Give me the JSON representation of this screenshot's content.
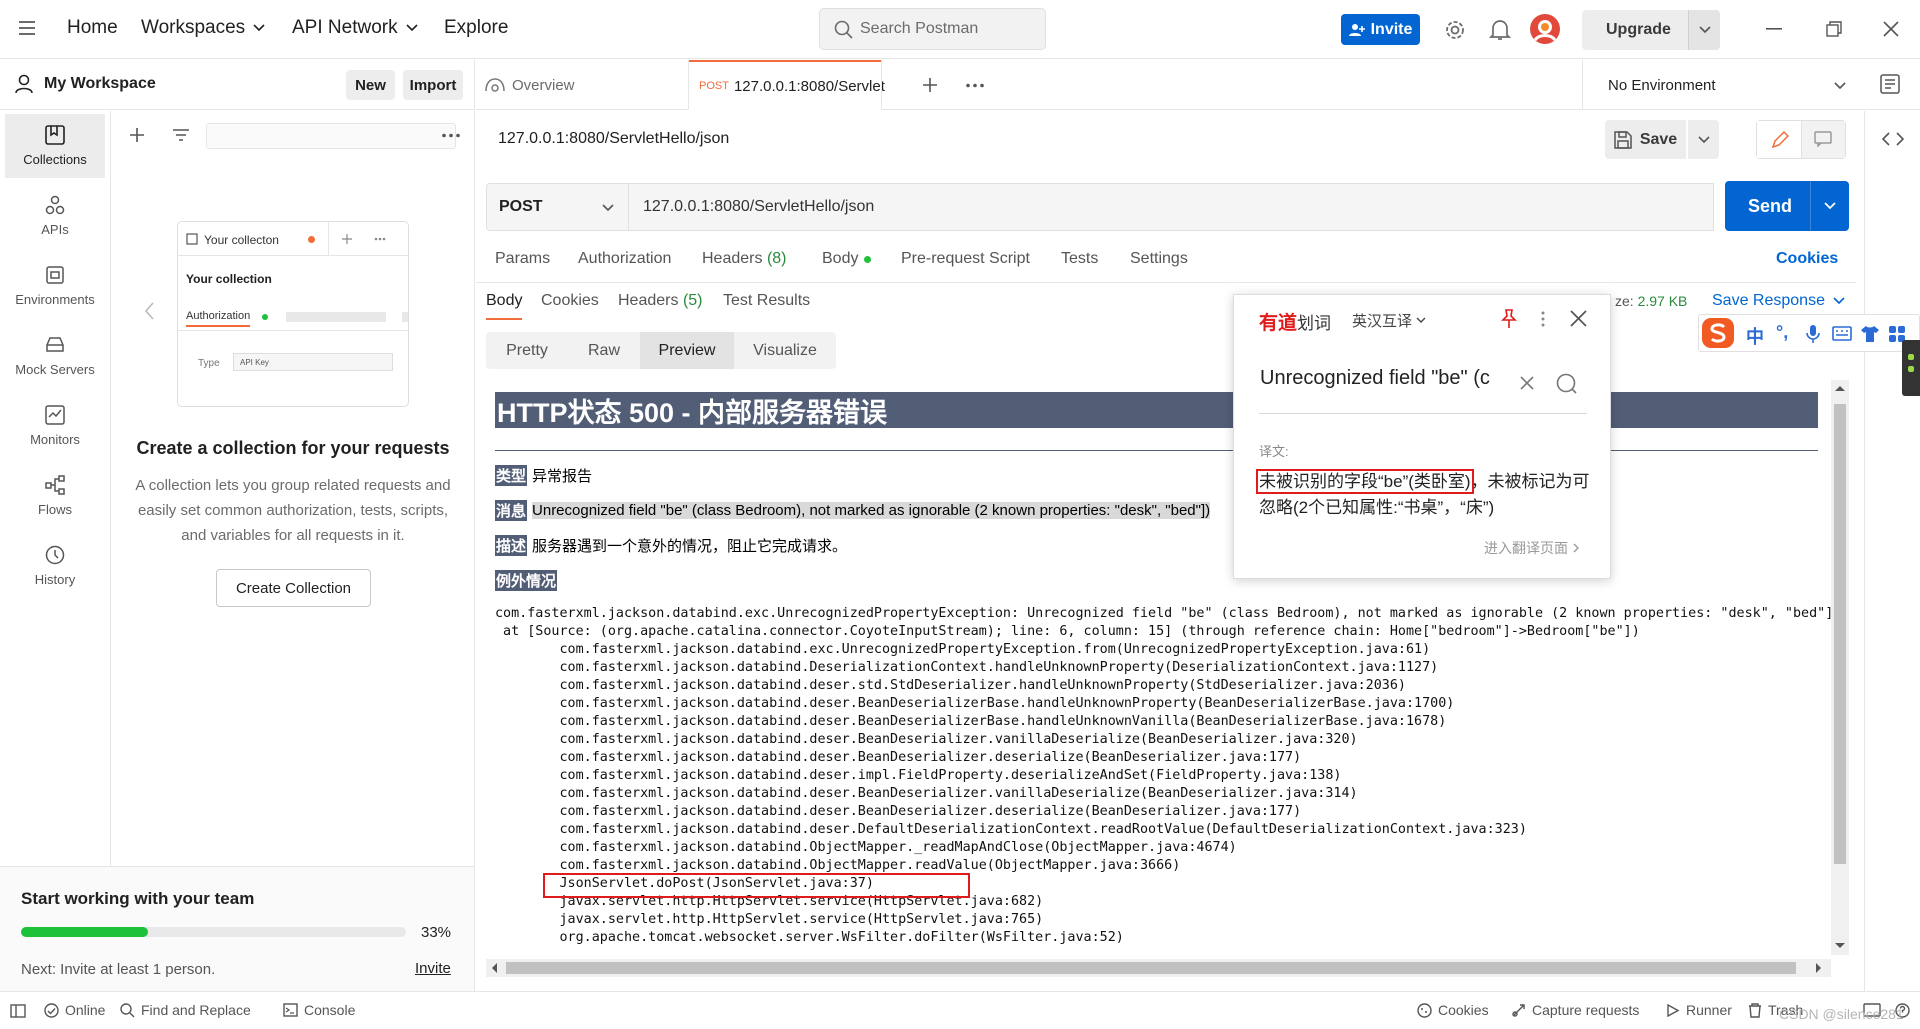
{
  "topbar": {
    "home": "Home",
    "workspaces": "Workspaces",
    "api_network": "API Network",
    "explore": "Explore",
    "search_placeholder": "Search Postman",
    "invite": "Invite",
    "upgrade": "Upgrade"
  },
  "workspace": {
    "title": "My Workspace",
    "new": "New",
    "import": "Import"
  },
  "leftnav": [
    {
      "label": "Collections",
      "icon": "collections-icon"
    },
    {
      "label": "APIs",
      "icon": "apis-icon"
    },
    {
      "label": "Environments",
      "icon": "environments-icon"
    },
    {
      "label": "Mock Servers",
      "icon": "mock-servers-icon"
    },
    {
      "label": "Monitors",
      "icon": "monitors-icon"
    },
    {
      "label": "Flows",
      "icon": "flows-icon"
    },
    {
      "label": "History",
      "icon": "history-icon"
    }
  ],
  "collection_empty": {
    "illus_tab": "Your collecton",
    "illus_name": "Your collection",
    "illus_auth": "Authorization",
    "illus_type": "Type",
    "illus_type_value": "API Key",
    "title": "Create a collection for your requests",
    "desc": "A collection lets you group related requests and easily set common authorization, tests, scripts, and variables for all requests in it.",
    "button": "Create Collection"
  },
  "team": {
    "title": "Start working with your team",
    "progress": 0.33,
    "progress_label": "33%",
    "next": "Next: Invite at least 1 person.",
    "invite": "Invite"
  },
  "tabs": {
    "overview": "Overview",
    "request_method": "POST",
    "request_label": "127.0.0.1:8080/Servlet"
  },
  "environment": "No Environment",
  "request": {
    "title": "127.0.0.1:8080/ServletHello/json",
    "save": "Save",
    "method": "POST",
    "url": "127.0.0.1:8080/ServletHello/json",
    "send": "Send"
  },
  "request_tabs": {
    "params": "Params",
    "authorization": "Authorization",
    "headers": "Headers",
    "headers_count": "(8)",
    "body": "Body",
    "prerequest": "Pre-request Script",
    "tests": "Tests",
    "settings": "Settings",
    "cookies": "Cookies"
  },
  "response_tabs": {
    "body": "Body",
    "cookies": "Cookies",
    "headers": "Headers",
    "headers_count": "(5)",
    "test_results": "Test Results",
    "size_prefix": "ze:",
    "size_value": "2.97 KB",
    "save_response": "Save Response"
  },
  "view_modes": [
    "Pretty",
    "Raw",
    "Preview",
    "Visualize"
  ],
  "preview": {
    "heading": "HTTP状态 500 - 内部服务器错误",
    "type_label": "类型",
    "type_value": "异常报告",
    "message_label": "消息",
    "message_value": "Unrecognized field \"be\" (class Bedroom), not marked as ignorable (2 known properties: \"desk\", \"bed\"])",
    "desc_label": "描述",
    "desc_value": "服务器遇到一个意外的情况，阻止它完成请求。",
    "exception_label": "例外情况",
    "stack": [
      "com.fasterxml.jackson.databind.exc.UnrecognizedPropertyException: Unrecognized field \"be\" (class Bedroom), not marked as ignorable (2 known properties: \"desk\", \"bed\"])",
      " at [Source: (org.apache.catalina.connector.CoyoteInputStream); line: 6, column: 15] (through reference chain: Home[\"bedroom\"]->Bedroom[\"be\"])",
      "\tcom.fasterxml.jackson.databind.exc.UnrecognizedPropertyException.from(UnrecognizedPropertyException.java:61)",
      "\tcom.fasterxml.jackson.databind.DeserializationContext.handleUnknownProperty(DeserializationContext.java:1127)",
      "\tcom.fasterxml.jackson.databind.deser.std.StdDeserializer.handleUnknownProperty(StdDeserializer.java:2036)",
      "\tcom.fasterxml.jackson.databind.deser.BeanDeserializerBase.handleUnknownProperty(BeanDeserializerBase.java:1700)",
      "\tcom.fasterxml.jackson.databind.deser.BeanDeserializerBase.handleUnknownVanilla(BeanDeserializerBase.java:1678)",
      "\tcom.fasterxml.jackson.databind.deser.BeanDeserializer.vanillaDeserialize(BeanDeserializer.java:320)",
      "\tcom.fasterxml.jackson.databind.deser.BeanDeserializer.deserialize(BeanDeserializer.java:177)",
      "\tcom.fasterxml.jackson.databind.deser.impl.FieldProperty.deserializeAndSet(FieldProperty.java:138)",
      "\tcom.fasterxml.jackson.databind.deser.BeanDeserializer.vanillaDeserialize(BeanDeserializer.java:314)",
      "\tcom.fasterxml.jackson.databind.deser.BeanDeserializer.deserialize(BeanDeserializer.java:177)",
      "\tcom.fasterxml.jackson.databind.deser.DefaultDeserializationContext.readRootValue(DefaultDeserializationContext.java:323)",
      "\tcom.fasterxml.jackson.databind.ObjectMapper._readMapAndClose(ObjectMapper.java:4674)",
      "\tcom.fasterxml.jackson.databind.ObjectMapper.readValue(ObjectMapper.java:3666)",
      "\tJsonServlet.doPost(JsonServlet.java:37)",
      "\tjavax.servlet.http.HttpServlet.service(HttpServlet.java:682)",
      "\tjavax.servlet.http.HttpServlet.service(HttpServlet.java:765)",
      "\torg.apache.tomcat.websocket.server.WsFilter.doFilter(WsFilter.java:52)"
    ]
  },
  "youdao": {
    "brand": "有道",
    "brand_suffix": "划词",
    "mode": "英汉互译",
    "query": "Unrecognized field \"be\" (c",
    "translation_label": "译文:",
    "translation_highlight": "未被识别的字段“be”(类卧室)",
    "translation_rest": "，未被标记为可忽略(2个已知属性:“书桌”，“床”)",
    "more": "进入翻译页面"
  },
  "ime": {
    "zh": "中",
    "punct": "°,"
  },
  "statusbar": {
    "online": "Online",
    "find_replace": "Find and Replace",
    "console": "Console",
    "cookies": "Cookies",
    "capture": "Capture requests",
    "runner": "Runner",
    "trash": "Trash",
    "watermark": "CSDN @silence281"
  },
  "colors": {
    "accent_blue": "#0265d2",
    "tab_orange": "#f26b3a",
    "tomcat_header": "#525d76",
    "progress_green": "#1ec13a",
    "highlight_red": "#e01b1b"
  }
}
